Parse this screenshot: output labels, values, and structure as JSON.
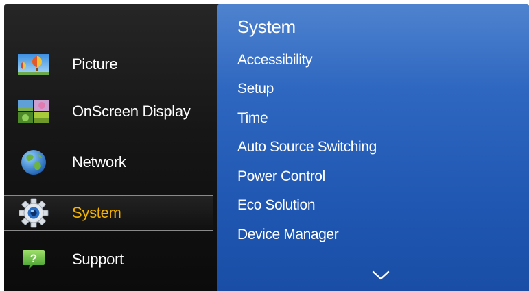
{
  "main_menu": {
    "items": [
      {
        "label": "Picture",
        "icon": "picture-icon"
      },
      {
        "label": "OnScreen Display",
        "icon": "onscreen-display-icon"
      },
      {
        "label": "Network",
        "icon": "network-globe-icon"
      },
      {
        "label": "System",
        "icon": "system-gear-icon",
        "selected": true
      },
      {
        "label": "Support",
        "icon": "support-question-icon"
      }
    ]
  },
  "submenu": {
    "title": "System",
    "items": [
      "Accessibility",
      "Setup",
      "Time",
      "Auto Source Switching",
      "Power Control",
      "Eco Solution",
      "Device Manager"
    ],
    "more_indicator": "chevron-down-icon"
  },
  "colors": {
    "selected_text": "#f5b400",
    "panel_blue": "#2e67c0",
    "background": "#161616"
  }
}
